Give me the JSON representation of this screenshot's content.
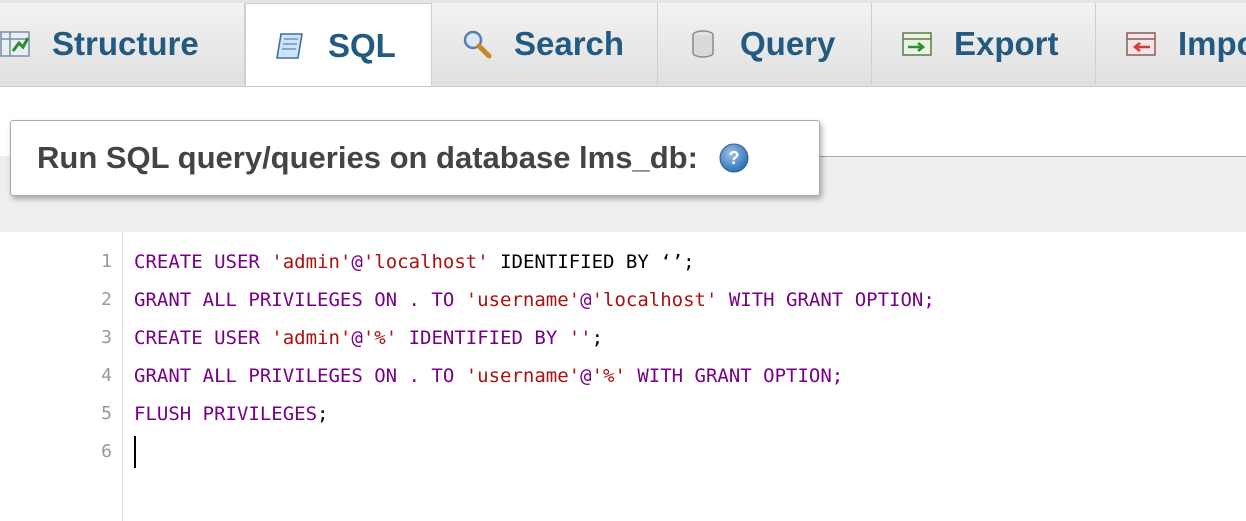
{
  "tabs": [
    {
      "label": "Structure",
      "icon": "structure-icon",
      "active": false
    },
    {
      "label": "SQL",
      "icon": "sql-icon",
      "active": true
    },
    {
      "label": "Search",
      "icon": "search-icon",
      "active": false
    },
    {
      "label": "Query",
      "icon": "query-icon",
      "active": false
    },
    {
      "label": "Export",
      "icon": "export-icon",
      "active": false
    },
    {
      "label": "Import",
      "icon": "import-icon",
      "active": false
    }
  ],
  "panel": {
    "title": "Run SQL query/queries on database lms_db:",
    "help_icon": "help-icon"
  },
  "editor": {
    "line_numbers": [
      "1",
      "2",
      "3",
      "4",
      "5",
      "6"
    ],
    "lines": [
      {
        "parts": [
          {
            "t": "CREATE USER ",
            "c": "kw"
          },
          {
            "t": "'admin'",
            "c": "str"
          },
          {
            "t": "@",
            "c": "kw"
          },
          {
            "t": "'localhost'",
            "c": "str"
          },
          {
            "t": " IDENTIFIED BY ",
            "c": "var"
          },
          {
            "t": "‘’",
            "c": "var"
          },
          {
            "t": ";",
            "c": "var"
          }
        ]
      },
      {
        "parts": [
          {
            "t": "GRANT ALL PRIVILEGES ON . TO ",
            "c": "kw"
          },
          {
            "t": "'username'",
            "c": "str"
          },
          {
            "t": "@",
            "c": "kw"
          },
          {
            "t": "'localhost'",
            "c": "str"
          },
          {
            "t": " WITH GRANT OPTION;",
            "c": "kw"
          }
        ]
      },
      {
        "parts": [
          {
            "t": "CREATE USER ",
            "c": "kw"
          },
          {
            "t": "'admin'",
            "c": "str"
          },
          {
            "t": "@",
            "c": "kw"
          },
          {
            "t": "'%'",
            "c": "str"
          },
          {
            "t": " IDENTIFIED BY ",
            "c": "kw"
          },
          {
            "t": "''",
            "c": "str"
          },
          {
            "t": ";",
            "c": "var"
          }
        ]
      },
      {
        "parts": [
          {
            "t": "GRANT ALL PRIVILEGES ON . TO ",
            "c": "kw"
          },
          {
            "t": "'username'",
            "c": "str"
          },
          {
            "t": "@",
            "c": "kw"
          },
          {
            "t": "'%'",
            "c": "str"
          },
          {
            "t": " WITH GRANT OPTION;",
            "c": "kw"
          }
        ]
      },
      {
        "parts": [
          {
            "t": "FLUSH PRIVILEGES",
            "c": "kw"
          },
          {
            "t": ";",
            "c": "var"
          }
        ]
      },
      {
        "parts": []
      }
    ]
  },
  "colors": {
    "tab_text": "#235a81",
    "keyword": "#770088",
    "string": "#aa1111"
  }
}
